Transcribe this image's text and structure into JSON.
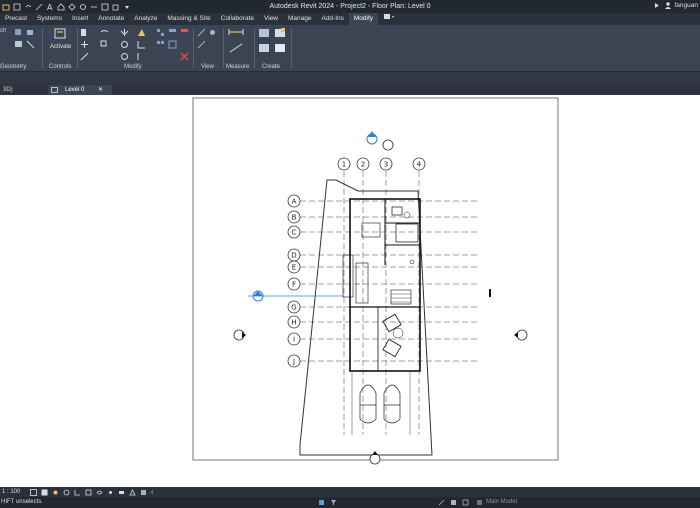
{
  "window": {
    "title": "Autodesk Revit 2024 - Project2 - Floor Plan: Level 0",
    "user": "fanguan"
  },
  "ribbon_tabs": [
    {
      "label": "Precast",
      "active": false
    },
    {
      "label": "Systems",
      "active": false
    },
    {
      "label": "Insert",
      "active": false
    },
    {
      "label": "Annotate",
      "active": false
    },
    {
      "label": "Analyze",
      "active": false
    },
    {
      "label": "Massing & Site",
      "active": false
    },
    {
      "label": "Collaborate",
      "active": false
    },
    {
      "label": "View",
      "active": false
    },
    {
      "label": "Manage",
      "active": false
    },
    {
      "label": "Add-Ins",
      "active": false
    },
    {
      "label": "Modify",
      "active": true
    }
  ],
  "ribbon": {
    "geometry_label": "Geometry",
    "controls_label": "Controls",
    "activate_label": "Activate",
    "modify_label": "Modify",
    "view_label": "View",
    "measure_label": "Measure",
    "create_label": "Create",
    "partial_label": "ch"
  },
  "view_tabs": {
    "partial_label": "3D)",
    "active_label": "Level 0",
    "close_symbol": "✕"
  },
  "plan": {
    "grid_numbers": [
      "1",
      "2",
      "3",
      "4"
    ],
    "grid_letters": [
      "A",
      "B",
      "C",
      "D",
      "E",
      "F",
      "G",
      "H",
      "I",
      "J"
    ]
  },
  "view_control": {
    "scale": "1 : 100",
    "collapse": "‹"
  },
  "status": {
    "message": "HIFT unselects.",
    "model": "Main Model"
  },
  "colors": {
    "title_bg": "#222831",
    "tab_bg": "#2b313b",
    "ribbon_bg": "#3b4453",
    "accent_blue": "#2f7fd8"
  }
}
